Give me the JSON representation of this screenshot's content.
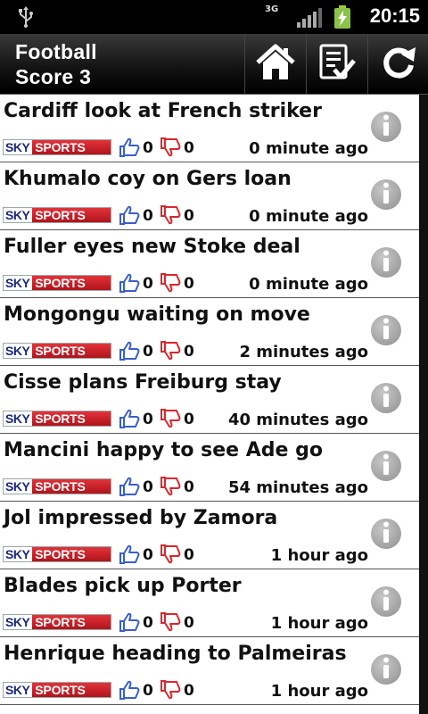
{
  "status_bar": {
    "network": "3G",
    "time": "20:15",
    "icons": [
      "usb-icon",
      "signal-icon",
      "battery-charging-icon"
    ]
  },
  "app_bar": {
    "title_line1": "Football",
    "title_line2": "Score 3",
    "actions": [
      "home-icon",
      "checklist-icon",
      "refresh-icon"
    ]
  },
  "news": [
    {
      "headline": "Cardiff look at French striker",
      "source": [
        "SKY",
        "SPORTS"
      ],
      "likes": "0",
      "dislikes": "0",
      "time": "0 minute ago"
    },
    {
      "headline": "Khumalo coy on Gers loan",
      "source": [
        "SKY",
        "SPORTS"
      ],
      "likes": "0",
      "dislikes": "0",
      "time": "0 minute ago"
    },
    {
      "headline": "Fuller eyes new Stoke deal",
      "source": [
        "SKY",
        "SPORTS"
      ],
      "likes": "0",
      "dislikes": "0",
      "time": "0 minute ago"
    },
    {
      "headline": "Mongongu waiting on move",
      "source": [
        "SKY",
        "SPORTS"
      ],
      "likes": "0",
      "dislikes": "0",
      "time": "2 minutes ago"
    },
    {
      "headline": "Cisse plans Freiburg stay",
      "source": [
        "SKY",
        "SPORTS"
      ],
      "likes": "0",
      "dislikes": "0",
      "time": "40 minutes ago"
    },
    {
      "headline": "Mancini happy to see Ade go",
      "source": [
        "SKY",
        "SPORTS"
      ],
      "likes": "0",
      "dislikes": "0",
      "time": "54 minutes ago"
    },
    {
      "headline": "Jol impressed by Zamora",
      "source": [
        "SKY",
        "SPORTS"
      ],
      "likes": "0",
      "dislikes": "0",
      "time": "1 hour ago"
    },
    {
      "headline": "Blades pick up Porter",
      "source": [
        "SKY",
        "SPORTS"
      ],
      "likes": "0",
      "dislikes": "0",
      "time": "1 hour ago"
    },
    {
      "headline": "Henrique heading to Palmeiras",
      "source": [
        "SKY",
        "SPORTS"
      ],
      "likes": "0",
      "dislikes": "0",
      "time": "1 hour ago"
    }
  ],
  "colors": {
    "sky_blue": "#1b2a7a",
    "sky_red": "#c8202a",
    "thumb_up": "#3a5fc8",
    "thumb_down": "#d8282e"
  }
}
